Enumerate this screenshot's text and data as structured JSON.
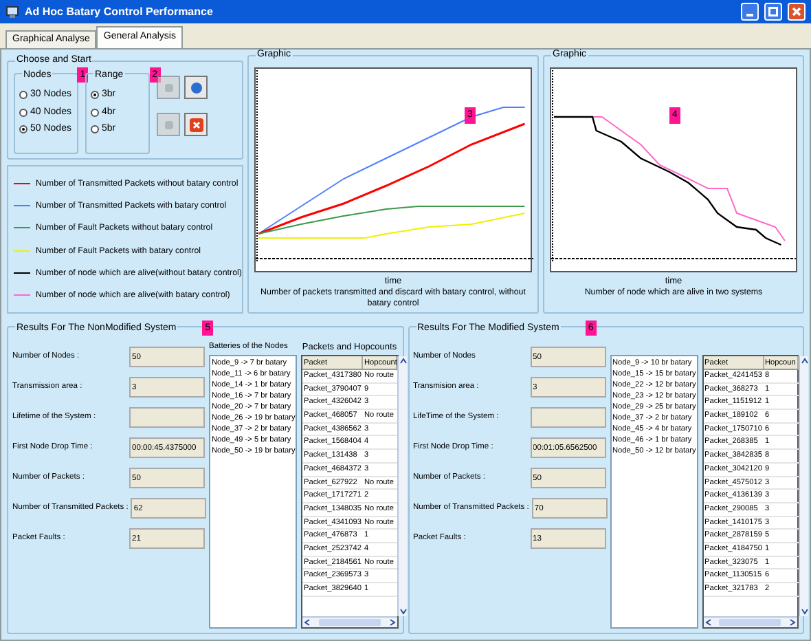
{
  "window": {
    "title": "Ad Hoc Batary Control Performance"
  },
  "tabs": [
    {
      "label": "Graphical Analyse",
      "selected": false
    },
    {
      "label": "General Analysis",
      "selected": true
    }
  ],
  "choose": {
    "title": "Choose and Start",
    "nodes": {
      "title": "Nodes",
      "badge": "1",
      "options": [
        {
          "label": "30 Nodes",
          "selected": false
        },
        {
          "label": "40 Nodes",
          "selected": false
        },
        {
          "label": "50 Nodes",
          "selected": true
        }
      ]
    },
    "range": {
      "title": "Range",
      "badge": "2",
      "options": [
        {
          "label": "3br",
          "selected": true
        },
        {
          "label": "4br",
          "selected": false
        },
        {
          "label": "5br",
          "selected": false
        }
      ]
    },
    "buttons": [
      {
        "kind": "gray",
        "disabled": true
      },
      {
        "kind": "blue",
        "disabled": false
      },
      {
        "kind": "gray",
        "disabled": true
      },
      {
        "kind": "stop",
        "disabled": false
      }
    ]
  },
  "legend": [
    {
      "label": "Number of Transmitted Packets without batary control",
      "color": "#ff0000"
    },
    {
      "label": "Number of Transmitted Packets with batary control",
      "color": "#4f7fff"
    },
    {
      "label": "Number of Fault Packets without batary control",
      "color": "#3a9a4a"
    },
    {
      "label": "Number of Fault Packets with batary control",
      "color": "#f0f000"
    },
    {
      "label": "Number of node which are alive(without batary control)",
      "color": "#000000"
    },
    {
      "label": "Number of node which are alive(with batary control)",
      "color": "#ff66cc"
    }
  ],
  "graphs": [
    {
      "title": "Graphic",
      "badge": "3",
      "xlabel": "time",
      "caption": "Number of packets transmitted and discard with batary control, without batary control"
    },
    {
      "title": "Graphic",
      "badge": "4",
      "xlabel": "time",
      "caption": "Number of node which are alive in two systems"
    }
  ],
  "results": [
    {
      "title": "Results For The NonModified System",
      "badge": "5",
      "fields": [
        {
          "label": "Number of Nodes :",
          "value": "50"
        },
        {
          "label": "Transmission area :",
          "value": "3"
        },
        {
          "label": "Lifetime of the System :"
        },
        {
          "label": "First Node Drop Time :",
          "value": "00:00:45.4375000"
        },
        {
          "label": "Number of Packets :",
          "value": "50"
        },
        {
          "label": "Number of Transmitted Packets :",
          "value": "62"
        },
        {
          "label": "Packet Faults :",
          "value": "21"
        }
      ],
      "batteries_title": "Batteries of the Nodes",
      "batteries": [
        "Node_9 -> 7 br batary",
        "Node_11 -> 6 br batary",
        "Node_14 -> 1 br batary",
        "Node_16 -> 7 br batary",
        "Node_20 -> 7 br batary",
        "Node_26 -> 19 br batary",
        "Node_37 -> 2 br batary",
        "Node_49 -> 5 br batary",
        "Node_50 -> 19 br batary"
      ],
      "packets_title": "Packets and Hopcounts",
      "columns": [
        "Packet",
        "Hopcount"
      ],
      "rows": [
        [
          "Packet_4317380",
          "No route"
        ],
        [
          "Packet_3790407",
          "9"
        ],
        [
          "Packet_4326042",
          "3"
        ],
        [
          "Packet_468057",
          "No route"
        ],
        [
          "Packet_4386562",
          "3"
        ],
        [
          "Packet_1568404",
          "4"
        ],
        [
          "Packet_131438",
          "3"
        ],
        [
          "Packet_4684372",
          "3"
        ],
        [
          "Packet_627922",
          "No route"
        ],
        [
          "Packet_1717271",
          "2"
        ],
        [
          "Packet_1348035",
          "No route"
        ],
        [
          "Packet_4341093",
          "No route"
        ],
        [
          "Packet_476873",
          "1"
        ],
        [
          "Packet_2523742",
          "4"
        ],
        [
          "Packet_2184561",
          "No route"
        ],
        [
          "Packet_2369573",
          "3"
        ],
        [
          "Packet_3829640",
          "1"
        ]
      ]
    },
    {
      "title": "Results For The Modified System",
      "badge": "6",
      "fields": [
        {
          "label": "Number of Nodes",
          "value": "50"
        },
        {
          "label": "Transmision area :",
          "value": "3"
        },
        {
          "label": "LifeTime of the System :"
        },
        {
          "label": "First Node Drop Time :",
          "value": "00:01:05.6562500"
        },
        {
          "label": "Number of Packets :",
          "value": "50"
        },
        {
          "label": "Number of Transmitted Packets :",
          "value": "70"
        },
        {
          "label": "Packet Faults :",
          "value": "13"
        }
      ],
      "batteries": [
        "Node_9 -> 10 br batary",
        "Node_15 -> 15 br batary",
        "Node_22 -> 12 br batary",
        "Node_23 -> 12 br batary",
        "Node_29 -> 25 br batary",
        "Node_37 -> 2 br batary",
        "Node_45 -> 4 br batary",
        "Node_46 -> 1 br batary",
        "Node_50 -> 12 br batary"
      ],
      "columns": [
        "Packet",
        "Hopcoun"
      ],
      "rows": [
        [
          "Packet_4241453",
          "8"
        ],
        [
          "Packet_368273",
          "1"
        ],
        [
          "Packet_1151912",
          "1"
        ],
        [
          "Packet_189102",
          "6"
        ],
        [
          "Packet_1750710",
          "6"
        ],
        [
          "Packet_268385",
          "1"
        ],
        [
          "Packet_3842835",
          "8"
        ],
        [
          "Packet_3042120",
          "9"
        ],
        [
          "Packet_4575012",
          "3"
        ],
        [
          "Packet_4136139",
          "3"
        ],
        [
          "Packet_290085",
          "3"
        ],
        [
          "Packet_1410175",
          "3"
        ],
        [
          "Packet_2878159",
          "5"
        ],
        [
          "Packet_4184750",
          "1"
        ],
        [
          "Packet_323075",
          "1"
        ],
        [
          "Packet_1130515",
          "6"
        ],
        [
          "Packet_321783",
          "2"
        ]
      ]
    }
  ]
}
